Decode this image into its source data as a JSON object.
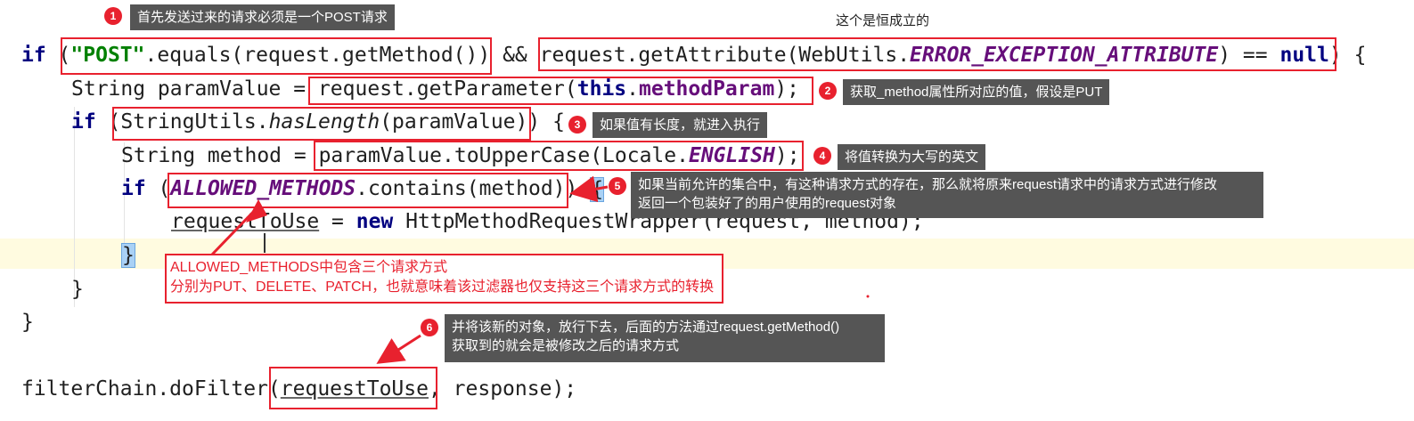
{
  "code": {
    "l1": {
      "kw_if": "if",
      "paren_open": " (",
      "post": "\"POST\"",
      "equals": ".equals(request.getMethod())",
      "and": " && ",
      "getattr": "request.getAttribute(WebUtils.",
      "err": "ERROR_EXCEPTION_ATTRIBUTE",
      "eqnull": ") == ",
      "null": "null",
      "close": ") {"
    },
    "l2": {
      "prefix": "String paramValue = ",
      "call": "request.getParameter(",
      "this": "this",
      "dot": ".",
      "field": "methodParam",
      "close": ");"
    },
    "l3": {
      "kw_if": "if",
      "open": " (",
      "cls": "StringUtils.",
      "method": "hasLength",
      "arg": "(paramValue)",
      "close": ") {"
    },
    "l4": {
      "prefix": "String method = ",
      "call": "paramValue.toUpperCase(Locale.",
      "const": "ENGLISH",
      "close": ");"
    },
    "l5": {
      "kw_if": "if",
      "open": " (",
      "const": "ALLOWED_METHODS",
      "call": ".contains(method)",
      "close": ") ",
      "brace": "{"
    },
    "l6": {
      "var": "requestToUse",
      "eq": " = ",
      "kw_new": "new",
      "rest": " HttpMethodRequestWrapper(request, method);"
    },
    "l7": {
      "brace": "}"
    },
    "l8": {
      "brace": "}"
    },
    "l9": {
      "brace": "}"
    },
    "l10": {
      "prefix": "filterChain.doFilter(",
      "var": "requestToUse",
      "rest": ", response);"
    }
  },
  "annotations": {
    "n1": {
      "num": "1",
      "text": "首先发送过来的请求必须是一个POST请求"
    },
    "n_top": {
      "text": "这个是恒成立的"
    },
    "n2": {
      "num": "2",
      "text": "获取_method属性所对应的值，假设是PUT"
    },
    "n3": {
      "num": "3",
      "text": "如果值有长度，就进入执行"
    },
    "n4": {
      "num": "4",
      "text": "将值转换为大写的英文"
    },
    "n5": {
      "num": "5",
      "line1": "如果当前允许的集合中，有这种请求方式的存在，那么就将原来request请求中的请求方式进行修改",
      "line2": "返回一个包装好了的用户使用的request对象"
    },
    "allowed": {
      "line1": "ALLOWED_METHODS中包含三个请求方式",
      "line2": "分别为PUT、DELETE、PATCH，也就意味着该过滤器也仅支持这三个请求方式的转换"
    },
    "n6": {
      "num": "6",
      "line1": "并将该新的对象，放行下去，后面的方法通过request.getMethod()",
      "line2": "获取到的就会是被修改之后的请求方式"
    }
  },
  "colors": {
    "annotation_red": "#e8212e",
    "note_bg": "#555555",
    "keyword": "#000080",
    "string": "#008000",
    "constant": "#660e7a",
    "current_line": "#fffbe0"
  }
}
